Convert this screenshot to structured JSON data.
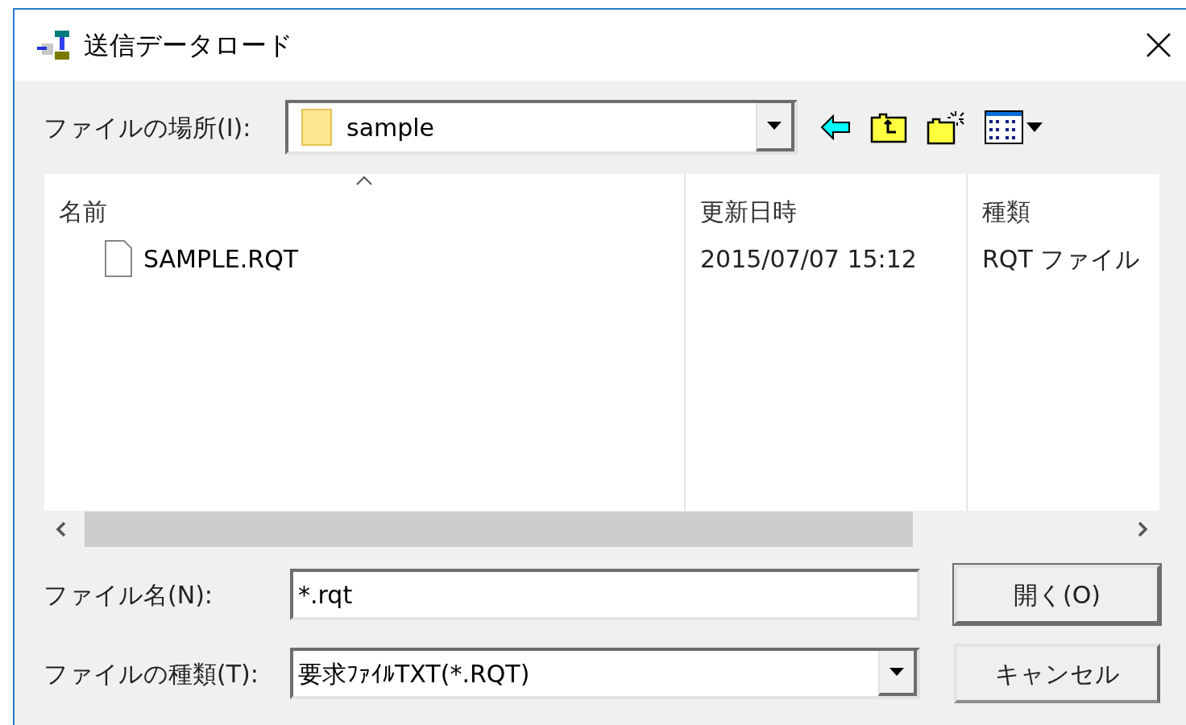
{
  "window": {
    "title": "送信データロード"
  },
  "look_in": {
    "label": "ファイルの場所(I):",
    "value": "sample"
  },
  "file_list": {
    "columns": [
      {
        "label": "名前",
        "sorted": true
      },
      {
        "label": "更新日時",
        "sorted": false
      },
      {
        "label": "種類",
        "sorted": false
      }
    ],
    "rows": [
      {
        "name": "SAMPLE.RQT",
        "modified": "2015/07/07 15:12",
        "type": "RQT ファイル",
        "selected": false
      }
    ]
  },
  "file_name": {
    "label": "ファイル名(N):",
    "value": "*.rqt"
  },
  "file_type": {
    "label": "ファイルの種類(T):",
    "value": "要求ﾌｧｲﾙTXT(*.RQT)"
  },
  "buttons": [
    {
      "label": "開く(O)",
      "default": true
    },
    {
      "label": "キャンセル",
      "default": false
    }
  ]
}
